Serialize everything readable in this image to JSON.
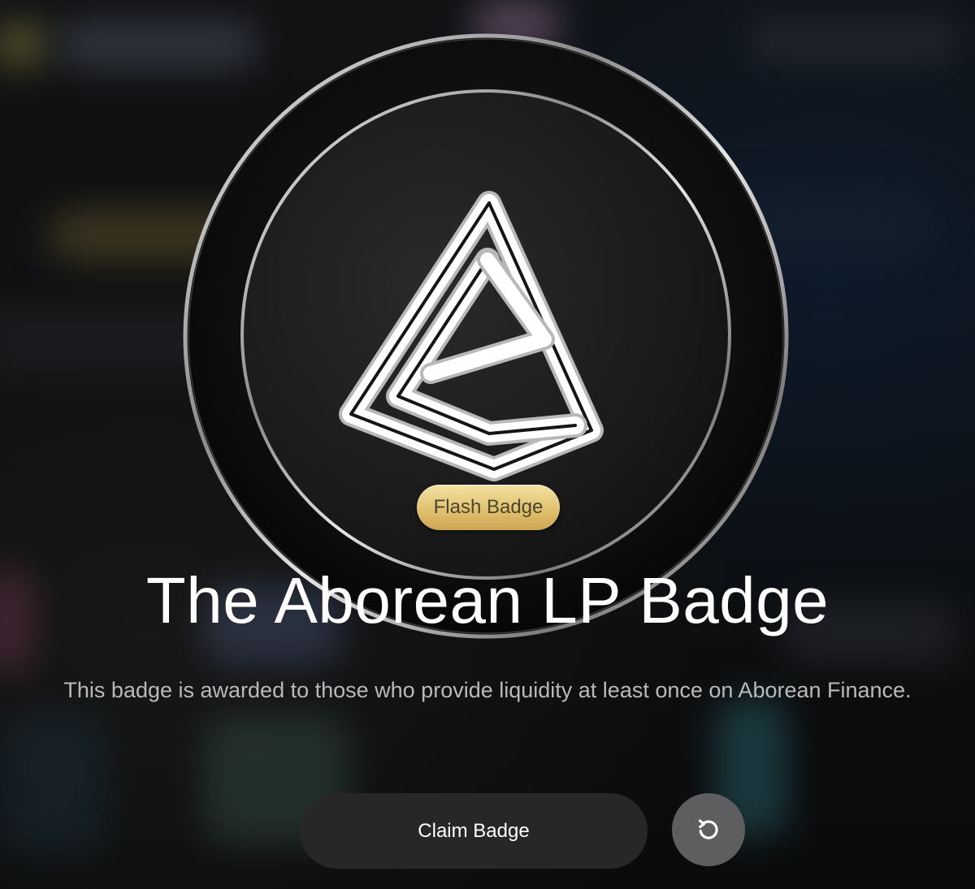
{
  "badge": {
    "tag_label": "Flash Badge",
    "title": "The Aborean LP Badge",
    "description": "This badge is awarded to those who provide liquidity at least once on Aborean Finance."
  },
  "actions": {
    "claim_label": "Claim Badge",
    "refresh_icon": "refresh-icon"
  },
  "colors": {
    "tag_gold": "#e1c16f",
    "button_bg": "#272729",
    "refresh_bg": "#5e5e60",
    "description_text": "#b9b9b9"
  }
}
